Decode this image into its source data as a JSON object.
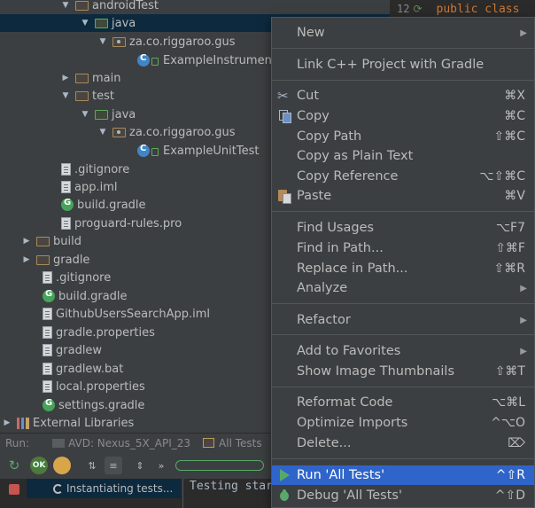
{
  "tree": {
    "items": [
      {
        "label": "androidTest"
      },
      {
        "label": "java"
      },
      {
        "label": "za.co.riggaroo.gus"
      },
      {
        "label": "ExampleInstrument"
      },
      {
        "label": "main"
      },
      {
        "label": "test"
      },
      {
        "label": "java"
      },
      {
        "label": "za.co.riggaroo.gus"
      },
      {
        "label": "ExampleUnitTest"
      },
      {
        "label": ".gitignore"
      },
      {
        "label": "app.iml"
      },
      {
        "label": "build.gradle"
      },
      {
        "label": "proguard-rules.pro"
      },
      {
        "label": "build"
      },
      {
        "label": "gradle"
      },
      {
        "label": ".gitignore"
      },
      {
        "label": "build.gradle"
      },
      {
        "label": "GithubUsersSearchApp.iml"
      },
      {
        "label": "gradle.properties"
      },
      {
        "label": "gradlew"
      },
      {
        "label": "gradlew.bat"
      },
      {
        "label": "local.properties"
      },
      {
        "label": "settings.gradle"
      },
      {
        "label": "External Libraries"
      }
    ]
  },
  "editor": {
    "line_number": "12",
    "code": "public class"
  },
  "run_bar": {
    "label": "Run:",
    "avd": "AVD: Nexus_5X_API_23",
    "tests": "All Tests"
  },
  "toolbar": {
    "ok_label": "OK",
    "more_label": "»"
  },
  "bottom": {
    "instantiating": "Instantiating tests...",
    "console": "Testing star"
  },
  "menu": {
    "items": [
      {
        "label": "New",
        "shortcut": ""
      },
      {
        "label": "Link C++ Project with Gradle",
        "shortcut": ""
      },
      {
        "label": "Cut",
        "shortcut": "⌘X"
      },
      {
        "label": "Copy",
        "shortcut": "⌘C"
      },
      {
        "label": "Copy Path",
        "shortcut": "⇧⌘C"
      },
      {
        "label": "Copy as Plain Text",
        "shortcut": ""
      },
      {
        "label": "Copy Reference",
        "shortcut": "⌥⇧⌘C"
      },
      {
        "label": "Paste",
        "shortcut": "⌘V"
      },
      {
        "label": "Find Usages",
        "shortcut": "⌥F7"
      },
      {
        "label": "Find in Path...",
        "shortcut": "⇧⌘F"
      },
      {
        "label": "Replace in Path...",
        "shortcut": "⇧⌘R"
      },
      {
        "label": "Analyze",
        "shortcut": ""
      },
      {
        "label": "Refactor",
        "shortcut": ""
      },
      {
        "label": "Add to Favorites",
        "shortcut": ""
      },
      {
        "label": "Show Image Thumbnails",
        "shortcut": "⇧⌘T"
      },
      {
        "label": "Reformat Code",
        "shortcut": "⌥⌘L"
      },
      {
        "label": "Optimize Imports",
        "shortcut": "^⌥O"
      },
      {
        "label": "Delete...",
        "shortcut": "⌦"
      },
      {
        "label": "Run 'All Tests'",
        "shortcut": "^⇧R"
      },
      {
        "label": "Debug 'All Tests'",
        "shortcut": "^⇧D"
      }
    ]
  },
  "colors": {
    "menu_bg": "#3c3f41",
    "highlight": "#2f65ca",
    "tree_selection": "#0d293e",
    "run_green": "#59a869",
    "stop_red": "#c75450"
  }
}
